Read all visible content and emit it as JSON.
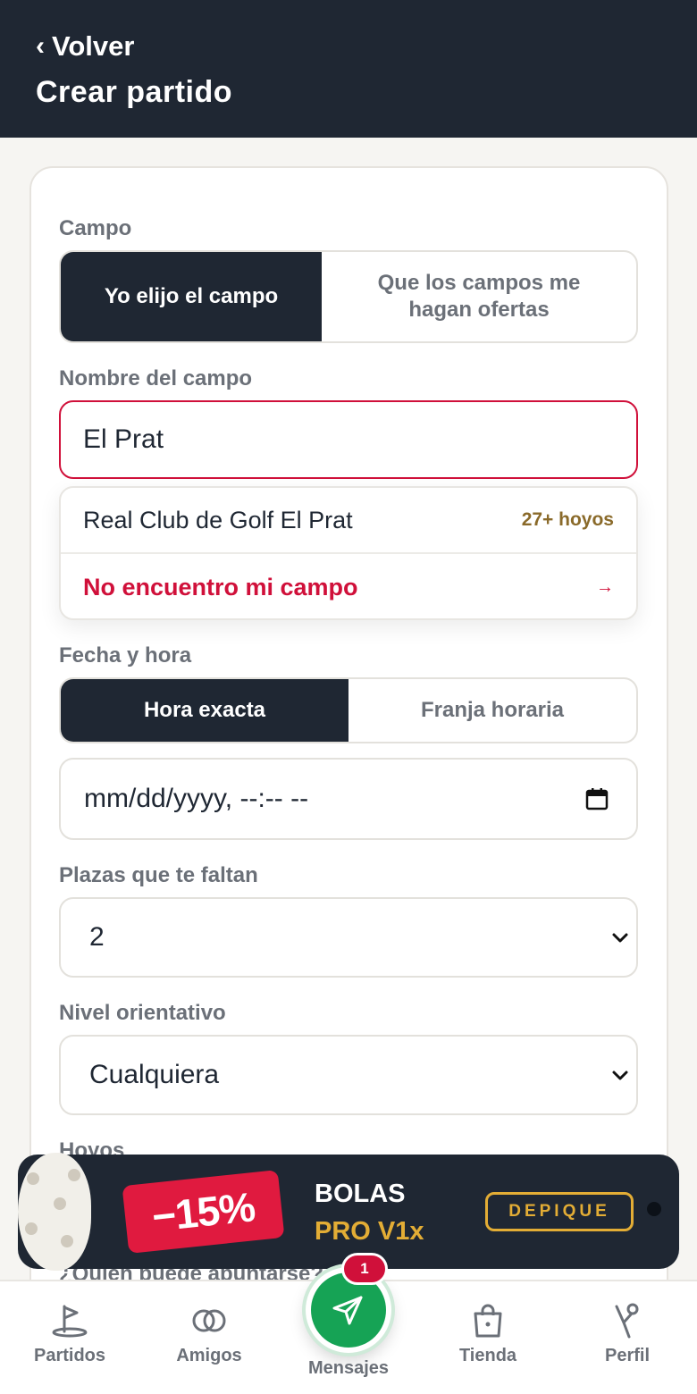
{
  "header": {
    "back_label": "Volver",
    "title": "Crear partido"
  },
  "form": {
    "campo": {
      "label": "Campo",
      "options": [
        "Yo elijo el campo",
        "Que los campos me hagan ofertas"
      ],
      "selected": "Yo elijo el campo"
    },
    "nombre_campo": {
      "label": "Nombre del campo",
      "value": "El Prat"
    },
    "suggestions": {
      "items": [
        {
          "name": "Real Club de Golf El Prat",
          "badge": "27+ hoyos"
        }
      ],
      "not_found": "No encuentro mi campo",
      "not_found_arrow": "→"
    },
    "fecha_hora": {
      "label": "Fecha y hora",
      "options": [
        "Hora exacta",
        "Franja horaria"
      ],
      "selected": "Hora exacta",
      "datetime_placeholder": "mm/dd/yyyy, --:-- --"
    },
    "plazas": {
      "label": "Plazas que te faltan",
      "value": "2"
    },
    "nivel": {
      "label": "Nivel orientativo",
      "value": "Cualquiera"
    },
    "hoyos": {
      "label": "Hoyos"
    },
    "quien": {
      "label": "¿Quién puede apuntarse?"
    }
  },
  "promo": {
    "discount": "−15%",
    "line1": "BOLAS",
    "line2": "PRO V1x",
    "button": "DEPIQUE",
    "accent_color": "#e3ad35",
    "tag_color": "#e01a3f"
  },
  "nav": {
    "items": [
      {
        "label": "Partidos",
        "icon": "golf-flag-icon"
      },
      {
        "label": "Amigos",
        "icon": "rings-icon"
      },
      {
        "label": "Mensajes",
        "icon": "paper-plane-icon",
        "badge": "1"
      },
      {
        "label": "Tienda",
        "icon": "shopping-bag-icon"
      },
      {
        "label": "Perfil",
        "icon": "golfer-icon"
      }
    ]
  },
  "colors": {
    "dark": "#1f2733",
    "error": "#d0103a",
    "primary_green": "#16a355",
    "muted": "#6b7078"
  }
}
